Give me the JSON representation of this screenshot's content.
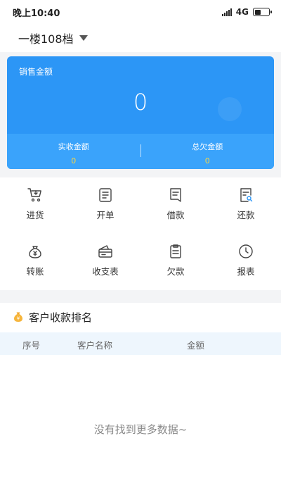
{
  "status": {
    "time": "晚上10:40",
    "network": "4G"
  },
  "store": {
    "name": "一楼108档"
  },
  "summary": {
    "title": "销售金额",
    "amount": "0",
    "received_label": "实收金额",
    "received_value": "0",
    "owed_label": "总欠金额",
    "owed_value": "0"
  },
  "menu": [
    {
      "label": "进货",
      "icon": "cart-icon"
    },
    {
      "label": "开单",
      "icon": "invoice-icon"
    },
    {
      "label": "借款",
      "icon": "document-icon"
    },
    {
      "label": "还款",
      "icon": "search-document-icon"
    },
    {
      "label": "转账",
      "icon": "money-bag-icon"
    },
    {
      "label": "收支表",
      "icon": "wallet-icon"
    },
    {
      "label": "欠款",
      "icon": "clipboard-icon"
    },
    {
      "label": "报表",
      "icon": "clock-icon"
    }
  ],
  "ranking": {
    "title": "客户收款排名",
    "columns": [
      "序号",
      "客户名称",
      "金额"
    ],
    "empty_text": "没有找到更多数据~"
  },
  "colors": {
    "accent": "#2c96f6",
    "value_yellow": "#ffd73d"
  }
}
